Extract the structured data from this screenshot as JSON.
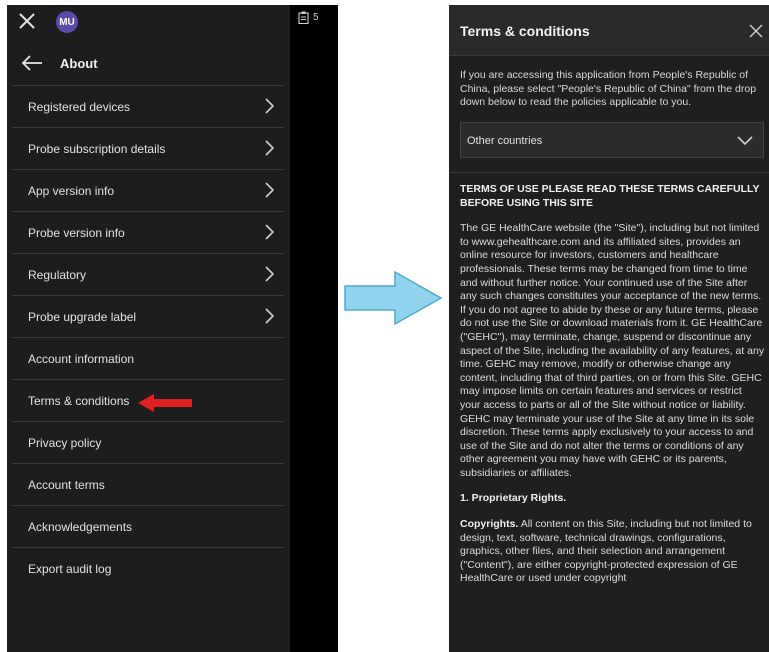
{
  "left_panel": {
    "avatar_initials": "MU",
    "header_title": "About",
    "menu": [
      {
        "label": "Registered devices",
        "has_chevron": true
      },
      {
        "label": "Probe subscription details",
        "has_chevron": true
      },
      {
        "label": "App version info",
        "has_chevron": true
      },
      {
        "label": "Probe version info",
        "has_chevron": true
      },
      {
        "label": "Regulatory",
        "has_chevron": true
      },
      {
        "label": "Probe upgrade label",
        "has_chevron": true
      },
      {
        "label": "Account information",
        "has_chevron": false
      },
      {
        "label": "Terms & conditions",
        "has_chevron": false
      },
      {
        "label": "Privacy policy",
        "has_chevron": false
      },
      {
        "label": "Account terms",
        "has_chevron": false
      },
      {
        "label": "Acknowledgements",
        "has_chevron": false
      },
      {
        "label": "Export audit log",
        "has_chevron": false
      }
    ]
  },
  "strip": {
    "badge_count": "5"
  },
  "right_panel": {
    "title": "Terms & conditions",
    "intro": "If you are accessing this application from People's Republic of China, please select \"People's Republic of China\" from the drop down below to read the policies applicable to you.",
    "select_value": "Other countries",
    "terms_heading": "TERMS OF USE PLEASE READ THESE TERMS CAREFULLY BEFORE USING THIS SITE",
    "terms_para": "The GE HealthCare website (the \"Site\"), including but not limited to www.gehealthcare.com and its affiliated sites, provides an online resource for investors, customers and healthcare professionals. These terms may be changed from time to time and without further notice. Your continued use of the Site after any such changes constitutes your acceptance of the new terms. If you do not agree to abide by these or any future terms, please do not use the Site or download materials from it. GE HealthCare (\"GEHC\"), may terminate, change, suspend or discontinue any aspect of the Site, including the availability of any features, at any time. GEHC may remove, modify or otherwise change any content, including that of third parties, on or from this Site. GEHC may impose limits on certain features and services or restrict your access to parts or all of the Site without notice or liability. GEHC may terminate your use of the Site at any time in its sole discretion. These terms apply exclusively to your access to and use of the Site and do not alter the terms or conditions of any other agreement you may have with GEHC or its parents, subsidiaries or affiliates.",
    "section1_title": "1. Proprietary Rights.",
    "copyrights_label": "Copyrights.",
    "copyrights_text": "All content on this Site, including but not limited to design, text, software, technical drawings, configurations, graphics, other files, and their selection and arrangement (\"Content\"), are either copyright-protected expression of GE HealthCare or used under copyright"
  },
  "colors": {
    "panel_bg": "#1d1d1d",
    "avatar": "#5b4aa8",
    "callout_arrow": "#e02020",
    "transition_arrow": "#8fd3ec"
  }
}
